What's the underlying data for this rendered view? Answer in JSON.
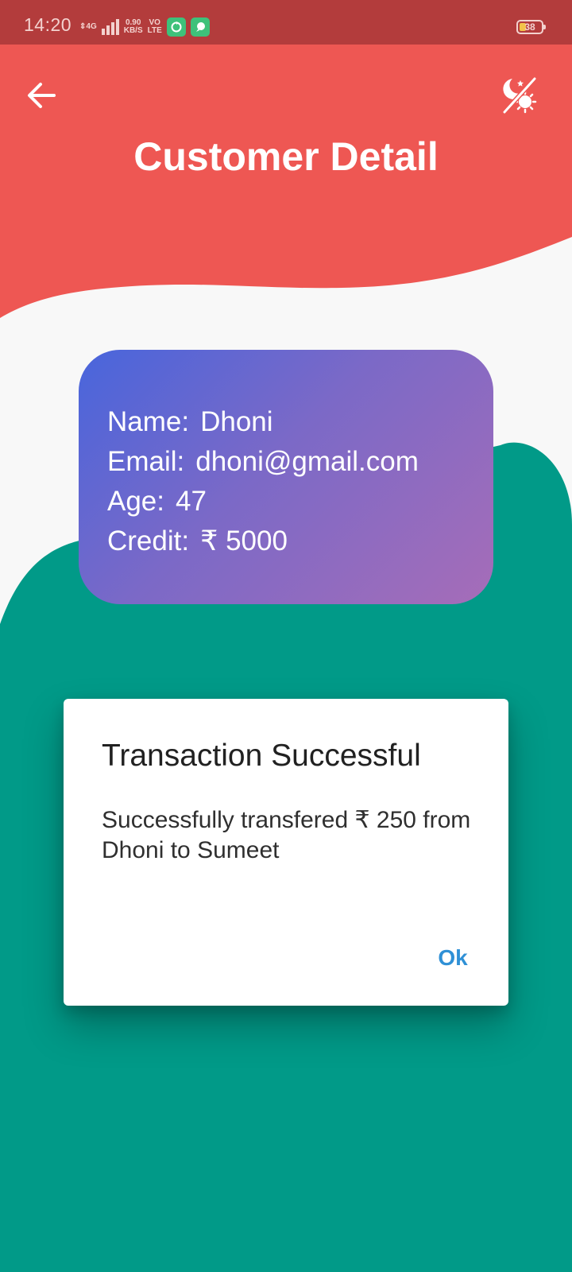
{
  "status_bar": {
    "time": "14:20",
    "network_type": "4G",
    "data_speed": "0.90",
    "data_unit": "KB/S",
    "volte_top": "VO",
    "volte_bottom": "LTE",
    "battery_level": "38"
  },
  "header": {
    "title": "Customer Detail",
    "back_icon": "arrow-left-icon",
    "theme_icon": "night-day-toggle-icon"
  },
  "customer": {
    "name_label": "Name:",
    "name": "Dhoni",
    "email_label": "Email:",
    "email": "dhoni@gmail.com",
    "age_label": "Age:",
    "age": "47",
    "credit_label": "Credit:",
    "credit": "₹ 5000"
  },
  "dialog": {
    "title": "Transaction Successful",
    "message": "Successfully transfered ₹ 250 from Dhoni to Sumeet",
    "ok_label": "Ok"
  },
  "colors": {
    "header_red": "#ee5753",
    "status_bar": "#b33c3c",
    "teal": "#019a88",
    "card_gradient_start": "#4865dc",
    "card_gradient_end": "#a66db8",
    "dialog_action": "#2f90d6"
  }
}
